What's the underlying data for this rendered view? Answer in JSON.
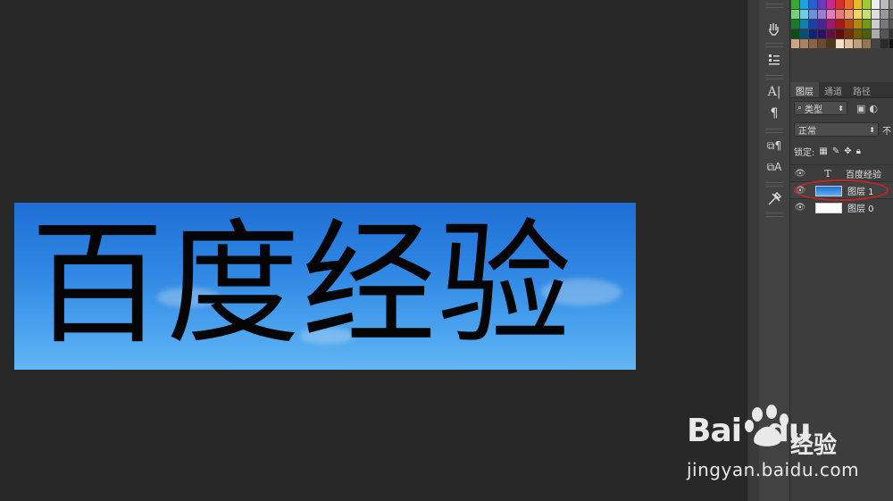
{
  "canvas": {
    "text": "百度经验"
  },
  "tools": [
    {
      "name": "brush-tool-icon",
      "glyph": "✋"
    },
    {
      "name": "clone-source-icon",
      "glyph": "☷"
    },
    {
      "name": "character-panel-icon",
      "glyph": "A|"
    },
    {
      "name": "paragraph-panel-icon",
      "glyph": "¶"
    },
    {
      "name": "paragraph-styles-icon",
      "glyph": "⧉"
    },
    {
      "name": "character-styles-icon",
      "glyph": "A"
    },
    {
      "name": "tool-presets-icon",
      "glyph": "✕"
    }
  ],
  "layers_panel": {
    "tabs": [
      "图层",
      "通道",
      "路径"
    ],
    "active_tab": 0,
    "filter_label": "类型",
    "blend_mode": "正常",
    "opacity_label": "不",
    "lock_label": "锁定:",
    "layers": [
      {
        "name": "百度经验",
        "kind": "text"
      },
      {
        "name": "图层 1",
        "kind": "image",
        "thumb_color": "#2a7de0"
      },
      {
        "name": "图层 0",
        "kind": "image",
        "thumb_color": "#ffffff"
      }
    ]
  },
  "watermark": {
    "logo": "Bai",
    "logo2": "du",
    "cn": "经验",
    "url": "jingyan.baidu.com"
  },
  "colors": {
    "canvas_bg": "#282828",
    "highlight": "#c0262b"
  }
}
